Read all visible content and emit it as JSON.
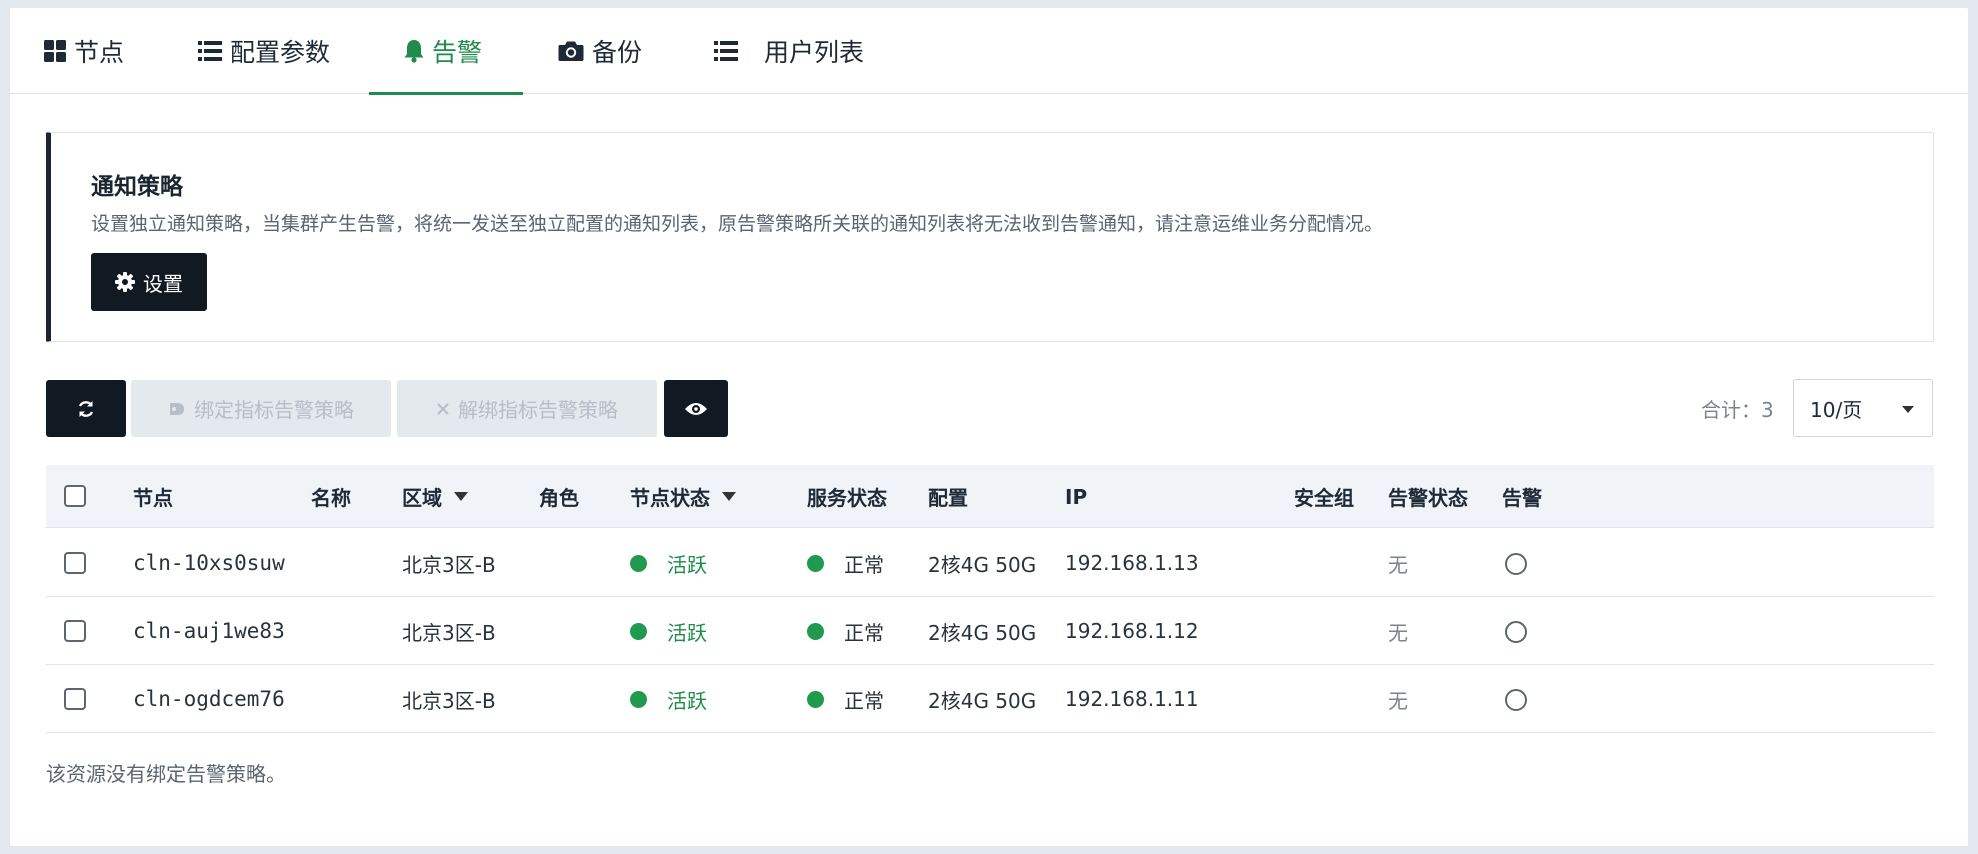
{
  "tabs": [
    {
      "label": "节点",
      "icon": "grid-icon"
    },
    {
      "label": "配置参数",
      "icon": "list-icon"
    },
    {
      "label": "告警",
      "icon": "bell-icon",
      "active": true
    },
    {
      "label": "备份",
      "icon": "camera-icon"
    },
    {
      "label": "用户列表",
      "icon": "list-icon"
    }
  ],
  "notice": {
    "title": "通知策略",
    "text": "设置独立通知策略，当集群产生告警，将统一发送至独立配置的通知列表，原告警策略所关联的通知列表将无法收到告警通知，请注意运维业务分配情况。",
    "settings_label": "设置"
  },
  "toolbar": {
    "bind_label": "绑定指标告警策略",
    "unbind_label": "解绑指标告警策略",
    "total": "合计：3",
    "page_size": "10/页"
  },
  "table": {
    "headers": {
      "node": "节点",
      "name": "名称",
      "zone": "区域",
      "role": "角色",
      "node_status": "节点状态",
      "service_status": "服务状态",
      "config": "配置",
      "ip": "IP",
      "security_group": "安全组",
      "alert_status": "告警状态",
      "alert": "告警"
    },
    "rows": [
      {
        "node": "cln-10xs0suw",
        "name": "",
        "zone": "北京3区-B",
        "role": "",
        "node_status": "活跃",
        "service_status": "正常",
        "config": "2核4G 50G",
        "ip": "192.168.1.13",
        "security_group": "",
        "alert_status": "无"
      },
      {
        "node": "cln-auj1we83",
        "name": "",
        "zone": "北京3区-B",
        "role": "",
        "node_status": "活跃",
        "service_status": "正常",
        "config": "2核4G 50G",
        "ip": "192.168.1.12",
        "security_group": "",
        "alert_status": "无"
      },
      {
        "node": "cln-ogdcem76",
        "name": "",
        "zone": "北京3区-B",
        "role": "",
        "node_status": "活跃",
        "service_status": "正常",
        "config": "2核4G 50G",
        "ip": "192.168.1.11",
        "security_group": "",
        "alert_status": "无"
      }
    ]
  },
  "footer_note": "该资源没有绑定告警策略。",
  "colors": {
    "accent": "#1f8b4c",
    "dark": "#111a22",
    "status_ok": "#1f9a4e"
  }
}
